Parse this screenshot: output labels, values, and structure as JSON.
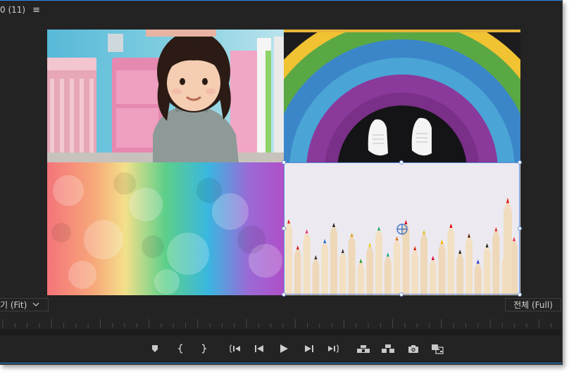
{
  "panel": {
    "title": "0 (11)",
    "menu_glyph": "≡"
  },
  "viewer": {
    "images": [
      {
        "name": "toddler-photo",
        "description_icon": "photo"
      },
      {
        "name": "rainbow-sneakers-photo",
        "description_icon": "photo"
      },
      {
        "name": "rainbow-smoke-photo",
        "description_icon": "photo"
      },
      {
        "name": "colored-pencils-photo",
        "description_icon": "photo"
      }
    ],
    "selected_index": 3
  },
  "zoom": {
    "label": "기 (Fit)",
    "chevron": "v"
  },
  "resolution": {
    "label": "전체 (Full)"
  },
  "controls": [
    {
      "name": "add-marker-button",
      "icon": "marker-icon"
    },
    {
      "name": "mark-in-button",
      "icon": "mark-in-icon"
    },
    {
      "name": "mark-out-button",
      "icon": "mark-out-icon"
    },
    {
      "name": "go-to-in-button",
      "icon": "go-to-in-icon"
    },
    {
      "name": "step-back-button",
      "icon": "step-back-icon"
    },
    {
      "name": "play-button",
      "icon": "play-icon"
    },
    {
      "name": "step-forward-button",
      "icon": "step-forward-icon"
    },
    {
      "name": "go-to-out-button",
      "icon": "go-to-out-icon"
    },
    {
      "name": "lift-button",
      "icon": "lift-icon"
    },
    {
      "name": "extract-button",
      "icon": "extract-icon"
    },
    {
      "name": "export-frame-button",
      "icon": "camera-icon"
    },
    {
      "name": "comparison-view-button",
      "icon": "comparison-icon"
    }
  ],
  "colors": {
    "panel_bg": "#232323",
    "accent_border": "#2d8ceb",
    "selection": "#5a88d6",
    "text": "#cfcfcf"
  }
}
